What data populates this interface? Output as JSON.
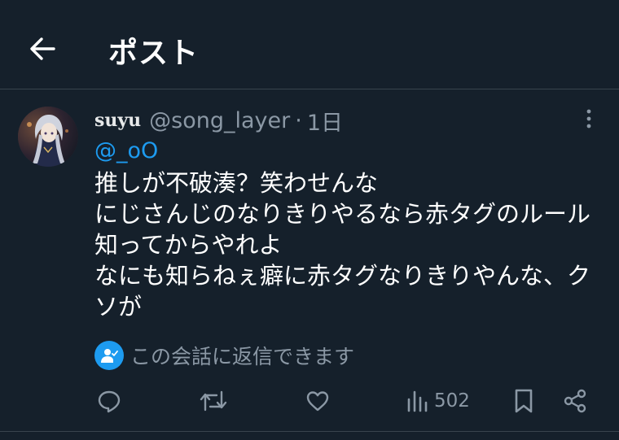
{
  "header": {
    "title": "ポスト",
    "back_icon": "arrow-left-icon"
  },
  "tweet": {
    "display_name": "suyu",
    "handle": "@song_layer",
    "separator": "·",
    "time": "1日",
    "mention": "@_oO",
    "lines": [
      "推しが不破湊？笑わせんな",
      "にじさんじのなりきりやるなら赤タグのルール",
      "知ってからやれよ",
      "なにも知らねぇ癖に赤タグなりきりやんな、ク",
      "ソが"
    ],
    "reply_restriction": "この会話に返信できます",
    "views": "502"
  },
  "icons": {
    "more": "more-vertical-icon",
    "reply": "reply-icon",
    "retweet": "retweet-icon",
    "like": "heart-icon",
    "views": "views-icon",
    "bookmark": "bookmark-icon",
    "share": "share-icon",
    "restriction": "mention-user-icon"
  },
  "colors": {
    "background": "#15202b",
    "text": "#e7e9ea",
    "secondary": "#8b98a5",
    "accent": "#1d9bf0",
    "divider": "#38444d"
  }
}
